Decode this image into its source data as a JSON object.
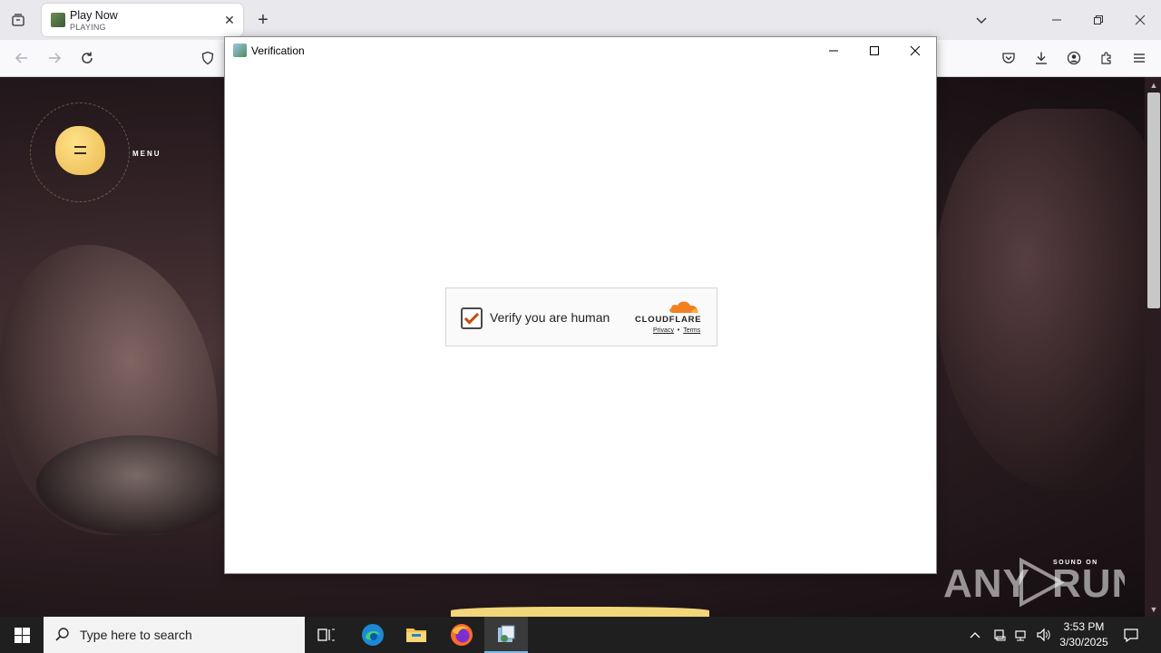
{
  "browser": {
    "tab": {
      "title": "Play Now",
      "subtitle": "PLAYING"
    },
    "new_tab_label": "+"
  },
  "page": {
    "menu_label": "MENU",
    "sound_label": "SOUND ON",
    "watermark": "ANY RUN"
  },
  "dialog": {
    "title": "Verification",
    "captcha": {
      "label": "Verify you are human",
      "brand": "CLOUDFLARE",
      "privacy": "Privacy",
      "separator": "•",
      "terms": "Terms",
      "checked": true
    }
  },
  "taskbar": {
    "search_placeholder": "Type here to search",
    "time": "3:53 PM",
    "date": "3/30/2025"
  },
  "colors": {
    "cloudflare_orange": "#f38020",
    "check": "#c44d0a",
    "taskbar": "#1f1f1f"
  }
}
